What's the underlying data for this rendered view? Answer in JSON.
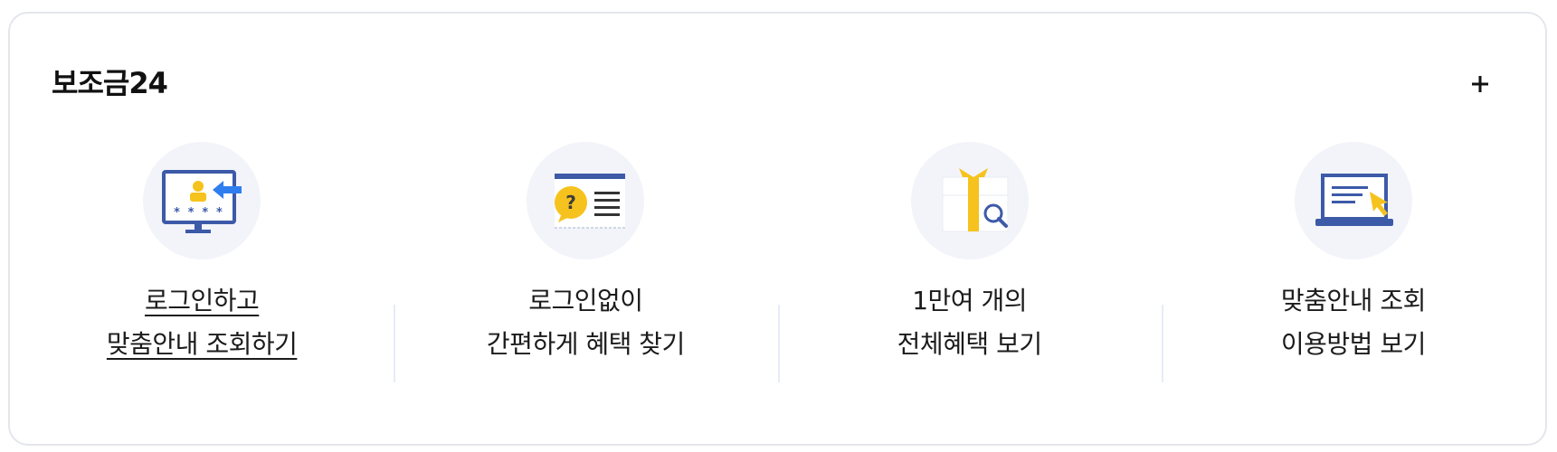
{
  "card": {
    "title": "보조금24",
    "more_label": "+"
  },
  "items": [
    {
      "line1": "로그인하고",
      "line2": "맞춤안내 조회하기",
      "icon": "login-monitor-icon"
    },
    {
      "line1": "로그인없이",
      "line2": "간편하게 혜택 찾기",
      "icon": "question-document-icon"
    },
    {
      "line1": "1만여 개의",
      "line2": "전체혜택 보기",
      "icon": "gift-search-icon"
    },
    {
      "line1": "맞춤안내 조회",
      "line2": "이용방법 보기",
      "icon": "laptop-pointer-icon"
    }
  ],
  "colors": {
    "icon_blue": "#3d5aa8",
    "icon_yellow": "#f6c21d",
    "icon_bg": "#f2f4f9",
    "divider": "#e6ecf6"
  }
}
